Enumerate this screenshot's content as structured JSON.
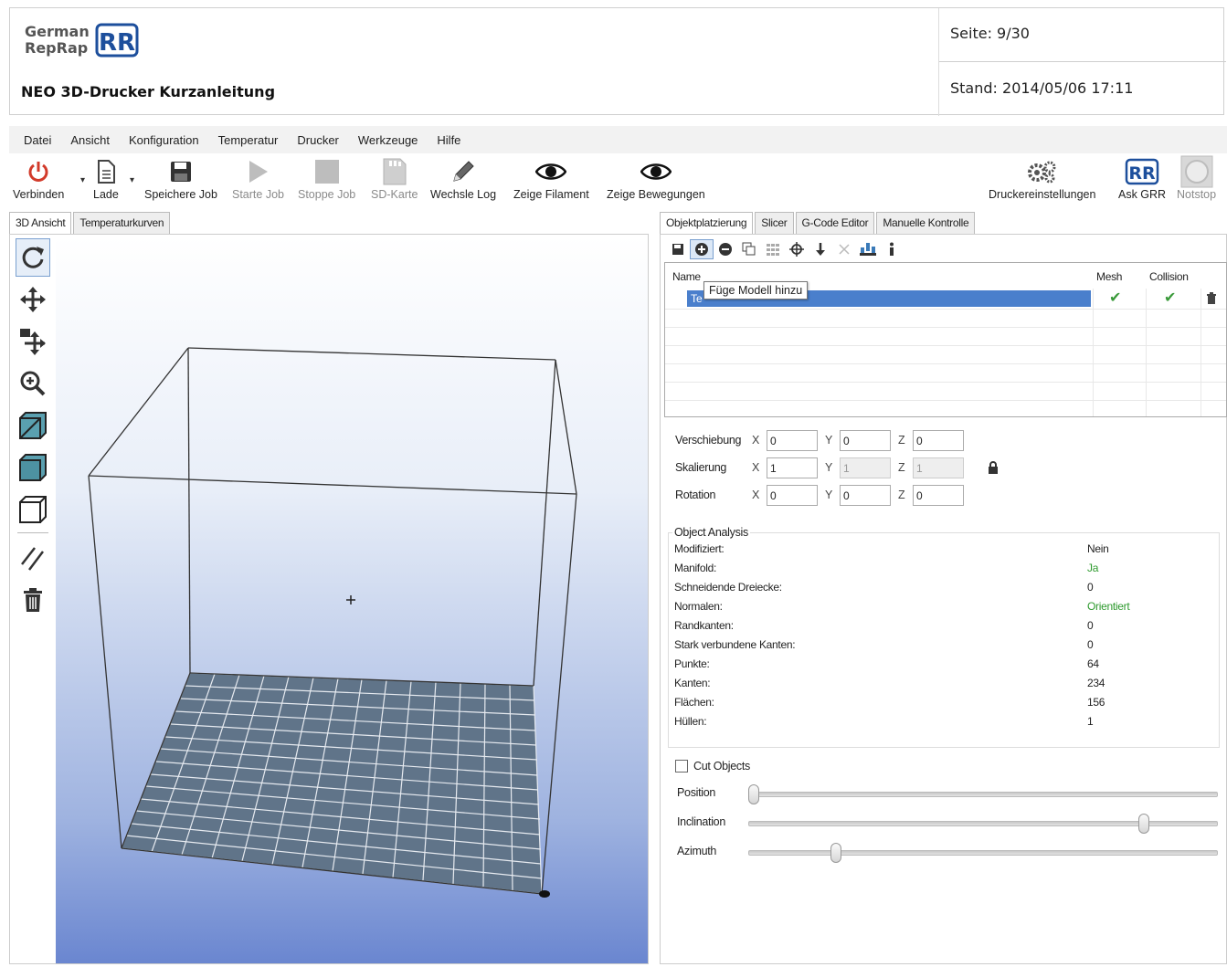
{
  "doc": {
    "logo_line1": "German",
    "logo_line2": "RepRap",
    "title": "NEO 3D-Drucker Kurzanleitung",
    "page": "Seite: 9/30",
    "date": "Stand: 2014/05/06 17:11"
  },
  "menu": [
    "Datei",
    "Ansicht",
    "Konfiguration",
    "Temperatur",
    "Drucker",
    "Werkzeuge",
    "Hilfe"
  ],
  "toolbar": {
    "connect": "Verbinden",
    "load": "Lade",
    "save_job": "Speichere Job",
    "start_job": "Starte Job",
    "stop_job": "Stoppe Job",
    "sd_card": "SD-Karte",
    "toggle_log": "Wechsle Log",
    "show_filament": "Zeige Filament",
    "show_moves": "Zeige Bewegungen",
    "printer_settings": "Druckereinstellungen",
    "ask_grr": "Ask GRR",
    "emergency_stop": "Notstop"
  },
  "left_tabs": [
    "3D Ansicht",
    "Temperaturkurven"
  ],
  "right_tabs": [
    "Objektplatzierung",
    "Slicer",
    "G-Code Editor",
    "Manuelle Kontrolle"
  ],
  "objects": {
    "col_name": "Name",
    "col_mesh": "Mesh",
    "col_collision": "Collision",
    "row_name": "Te",
    "tooltip": "Füge Modell hinzu"
  },
  "transform": {
    "translation_label": "Verschiebung",
    "scale_label": "Skalierung",
    "rotation_label": "Rotation",
    "axis_x": "X",
    "axis_y": "Y",
    "axis_z": "Z",
    "translation": {
      "x": "0",
      "y": "0",
      "z": "0"
    },
    "scale": {
      "x": "1",
      "y": "1",
      "z": "1"
    },
    "rotation": {
      "x": "0",
      "y": "0",
      "z": "0"
    }
  },
  "analysis": {
    "title": "Object Analysis",
    "rows": [
      {
        "k": "Modifiziert:",
        "v": "Nein",
        "color": "#222222"
      },
      {
        "k": "Manifold:",
        "v": "Ja",
        "color": "#2e9a2e"
      },
      {
        "k": "Schneidende Dreiecke:",
        "v": "0",
        "color": "#222222"
      },
      {
        "k": "Normalen:",
        "v": "Orientiert",
        "color": "#2e9a2e"
      },
      {
        "k": "Randkanten:",
        "v": "0",
        "color": "#222222"
      },
      {
        "k": "Stark verbundene Kanten:",
        "v": "0",
        "color": "#222222"
      },
      {
        "k": "Punkte:",
        "v": "64",
        "color": "#222222"
      },
      {
        "k": "Kanten:",
        "v": "234",
        "color": "#222222"
      },
      {
        "k": "Flächen:",
        "v": "156",
        "color": "#222222"
      },
      {
        "k": "Hüllen:",
        "v": "1",
        "color": "#222222"
      }
    ]
  },
  "cut": {
    "label": "Cut Objects",
    "position_label": "Position",
    "inclination_label": "Inclination",
    "azimuth_label": "Azimuth",
    "position": 0.0,
    "inclination": 0.85,
    "azimuth": 0.18
  },
  "colors": {
    "selection": "#4a7fcc",
    "ok_green": "#2e9a2e",
    "bed": "#607489",
    "power_red": "#d23b2b",
    "logo_blue": "#1d4f9c"
  }
}
